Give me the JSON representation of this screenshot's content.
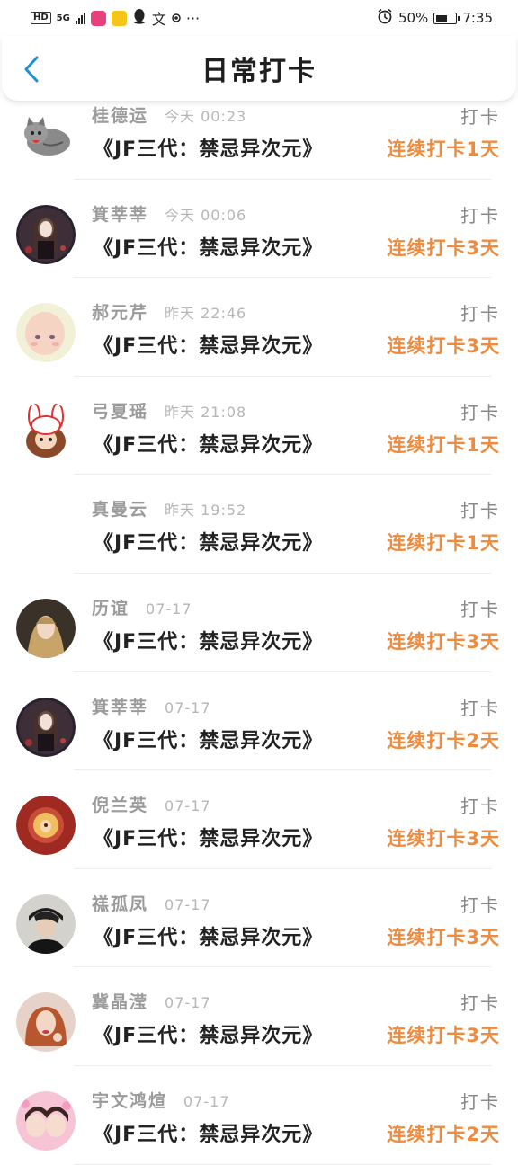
{
  "status_bar": {
    "hd": "HD",
    "network": "5G",
    "battery_text": "50%",
    "battery_level": 0.5,
    "time": "7:35",
    "dots": "···",
    "icons": [
      "hd-icon",
      "signal-icon",
      "app-icon-pink",
      "app-icon-weibo",
      "qq-icon",
      "text-icon",
      "dot-icon",
      "more-icon",
      "alarm-icon",
      "battery-icon"
    ]
  },
  "header": {
    "title": "日常打卡",
    "back_icon": "chevron-left-icon",
    "accent": "#1e90d6"
  },
  "colors": {
    "streak": "#f08a3c",
    "name": "#9b9b9b",
    "time": "#b6b6b6"
  },
  "items": [
    {
      "name": "桂德运",
      "time": "今天 00:23",
      "course": "《JF三代：禁忌异次元》",
      "action": "打卡",
      "streak": "连续打卡1天",
      "avatar": "cat-avatar"
    },
    {
      "name": "箕莘莘",
      "time": "今天 00:06",
      "course": "《JF三代：禁忌异次元》",
      "action": "打卡",
      "streak": "连续打卡3天",
      "avatar": "dark-girl-avatar"
    },
    {
      "name": "郝元芹",
      "time": "昨天 22:46",
      "course": "《JF三代：禁忌异次元》",
      "action": "打卡",
      "streak": "连续打卡3天",
      "avatar": "baby-avatar"
    },
    {
      "name": "弓夏瑶",
      "time": "昨天 21:08",
      "course": "《JF三代：禁忌异次元》",
      "action": "打卡",
      "streak": "连续打卡1天",
      "avatar": "bunny-avatar"
    },
    {
      "name": "真曼云",
      "time": "昨天 19:52",
      "course": "《JF三代：禁忌异次元》",
      "action": "打卡",
      "streak": "连续打卡1天",
      "avatar": "blank-avatar"
    },
    {
      "name": "历谊",
      "time": "07-17",
      "course": "《JF三代：禁忌异次元》",
      "action": "打卡",
      "streak": "连续打卡3天",
      "avatar": "blonde-avatar"
    },
    {
      "name": "箕莘莘",
      "time": "07-17",
      "course": "《JF三代：禁忌异次元》",
      "action": "打卡",
      "streak": "连续打卡2天",
      "avatar": "dark-girl-avatar"
    },
    {
      "name": "倪兰英",
      "time": "07-17",
      "course": "《JF三代：禁忌异次元》",
      "action": "打卡",
      "streak": "连续打卡3天",
      "avatar": "red-record-avatar"
    },
    {
      "name": "禚孤凤",
      "time": "07-17",
      "course": "《JF三代：禁忌异次元》",
      "action": "打卡",
      "streak": "连续打卡3天",
      "avatar": "boy-avatar"
    },
    {
      "name": "冀晶滢",
      "time": "07-17",
      "course": "《JF三代：禁忌异次元》",
      "action": "打卡",
      "streak": "连续打卡3天",
      "avatar": "redhead-avatar"
    },
    {
      "name": "宇文鸿煊",
      "time": "07-17",
      "course": "《JF三代：禁忌异次元》",
      "action": "打卡",
      "streak": "连续打卡2天",
      "avatar": "pink-duo-avatar"
    }
  ]
}
